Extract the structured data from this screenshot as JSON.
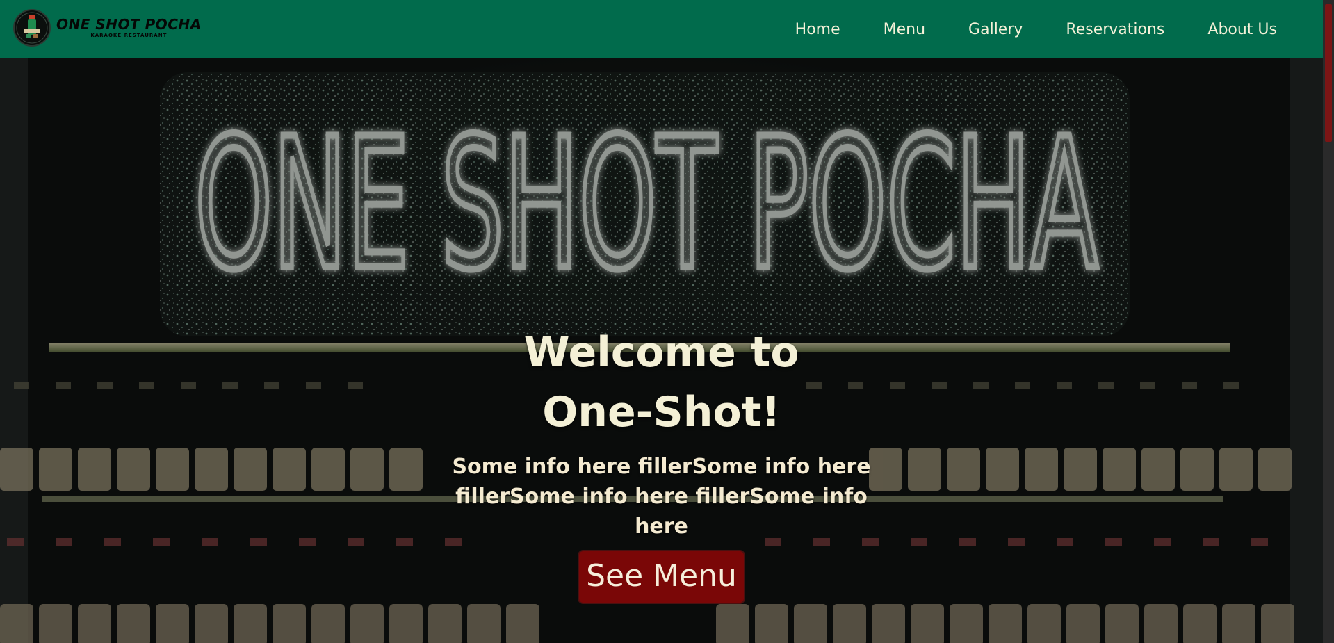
{
  "navbar": {
    "logo": {
      "name": "ONE SHOT POCHA",
      "subtitle": "KARAOKE RESTAURANT"
    },
    "links": [
      "Home",
      "Menu",
      "Gallery",
      "Reservations",
      "About Us"
    ],
    "background_color": "#016b4c",
    "link_color": "#f5f1d8"
  },
  "hero": {
    "neon_sign": "ONE SHOT POCHA",
    "title": "Welcome to One-Shot!",
    "text": "Some info here fillerSome info here fillerSome info here fillerSome info here",
    "button_label": "See Menu",
    "button_color": "#7a0707",
    "text_color": "#f4f0d6"
  },
  "scrollbar": {
    "thumb_color": "#7c1515"
  }
}
